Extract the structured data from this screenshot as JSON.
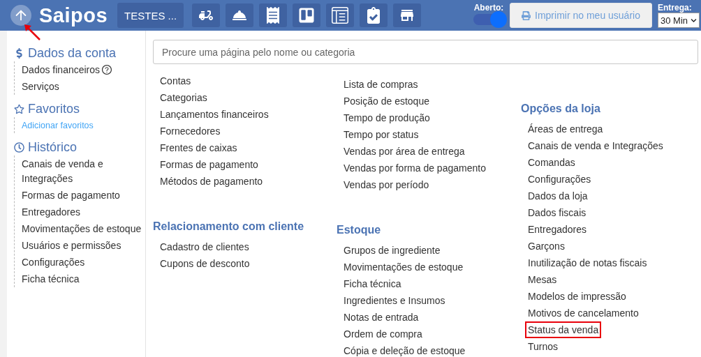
{
  "header": {
    "up_button_annotated": true,
    "logo": "Saipos",
    "store_button": "TESTES ...",
    "open_label": "Aberto:",
    "open_toggle": {
      "on": true
    },
    "print_button": {
      "label": "Imprimir no meu usuário",
      "disabled": true
    },
    "delivery_label": "Entrega:",
    "delivery_select": "30 Min"
  },
  "sidebar": {
    "sections": [
      {
        "title": "Dados da conta",
        "items": [
          {
            "label": "Dados financeiros",
            "kind": "page",
            "help": true
          },
          {
            "label": "Serviços",
            "kind": "page",
            "help": false
          }
        ]
      },
      {
        "title": "Favoritos",
        "items": [
          {
            "label": "Adicionar favoritos",
            "kind": "link",
            "help": false
          }
        ]
      },
      {
        "title": "Histórico",
        "items": [
          {
            "label": "Canais de venda e Integrações",
            "kind": "page",
            "help": false
          },
          {
            "label": "Formas de pagamento",
            "kind": "page",
            "help": false
          },
          {
            "label": "Entregadores",
            "kind": "page",
            "help": false
          },
          {
            "label": "Movimentações de estoque",
            "kind": "page",
            "help": false
          },
          {
            "label": "Usuários e permissões",
            "kind": "page",
            "help": false
          },
          {
            "label": "Configurações",
            "kind": "page",
            "help": false
          },
          {
            "label": "Ficha técnica",
            "kind": "page",
            "help": false
          }
        ]
      }
    ]
  },
  "search": {
    "placeholder": "Procure uma página pelo nome ou categoria"
  },
  "columns": [
    [
      {
        "items": [
          {
            "label": "Contas",
            "highlighted": false
          },
          {
            "label": "Categorias",
            "highlighted": false
          },
          {
            "label": "Lançamentos financeiros",
            "highlighted": false
          },
          {
            "label": "Fornecedores",
            "highlighted": false
          },
          {
            "label": "Frentes de caixas",
            "highlighted": false
          },
          {
            "label": "Formas de pagamento",
            "highlighted": false
          },
          {
            "label": "Métodos de pagamento",
            "highlighted": false
          }
        ]
      },
      {
        "title": "Relacionamento com cliente",
        "items": [
          {
            "label": "Cadastro de clientes",
            "highlighted": false
          },
          {
            "label": "Cupons de desconto",
            "highlighted": false
          }
        ]
      }
    ],
    [
      {
        "items": [
          {
            "label": "Lista de compras",
            "highlighted": false
          },
          {
            "label": "Posição de estoque",
            "highlighted": false
          },
          {
            "label": "Tempo de produção",
            "highlighted": false
          },
          {
            "label": "Tempo por status",
            "highlighted": false
          },
          {
            "label": "Vendas por área de entrega",
            "highlighted": false
          },
          {
            "label": "Vendas por forma de pagamento",
            "highlighted": false
          },
          {
            "label": "Vendas por período",
            "highlighted": false
          }
        ]
      },
      {
        "title": "Estoque",
        "items": [
          {
            "label": "Grupos de ingrediente",
            "highlighted": false
          },
          {
            "label": "Movimentações de estoque",
            "highlighted": false
          },
          {
            "label": "Ficha técnica",
            "highlighted": false
          },
          {
            "label": "Ingredientes e Insumos",
            "highlighted": false
          },
          {
            "label": "Notas de entrada",
            "highlighted": false
          },
          {
            "label": "Ordem de compra",
            "highlighted": false
          },
          {
            "label": "Cópia e deleção de estoque",
            "highlighted": false
          }
        ]
      }
    ],
    [
      {
        "title": "Opções da loja",
        "items": [
          {
            "label": "Áreas de entrega",
            "highlighted": false
          },
          {
            "label": "Canais de venda e Integrações",
            "highlighted": false
          },
          {
            "label": "Comandas",
            "highlighted": false
          },
          {
            "label": "Configurações",
            "highlighted": false
          },
          {
            "label": "Dados da loja",
            "highlighted": false
          },
          {
            "label": "Dados fiscais",
            "highlighted": false
          },
          {
            "label": "Entregadores",
            "highlighted": false
          },
          {
            "label": "Garçons",
            "highlighted": false
          },
          {
            "label": "Inutilização de notas fiscais",
            "highlighted": false
          },
          {
            "label": "Mesas",
            "highlighted": false
          },
          {
            "label": "Modelos de impressão",
            "highlighted": false
          },
          {
            "label": "Motivos de cancelamento",
            "highlighted": false
          },
          {
            "label": "Status da venda",
            "highlighted": true
          },
          {
            "label": "Turnos",
            "highlighted": false
          }
        ]
      }
    ]
  ]
}
